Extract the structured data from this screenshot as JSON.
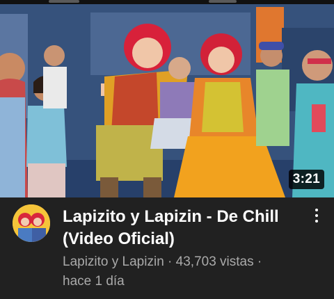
{
  "video": {
    "duration": "3:21",
    "title": "Lapizito y Lapizin - De Chill (Video Oficial)",
    "channel": "Lapizito y Lapizin",
    "views": "43,703 vistas",
    "age": "hace 1 día",
    "separator": " · "
  },
  "icons": {
    "menu": "more-vert-icon"
  },
  "colors": {
    "background": "#212121",
    "title_text": "#ffffff",
    "secondary_text": "#aaaaaa",
    "duration_badge": "#000000"
  }
}
